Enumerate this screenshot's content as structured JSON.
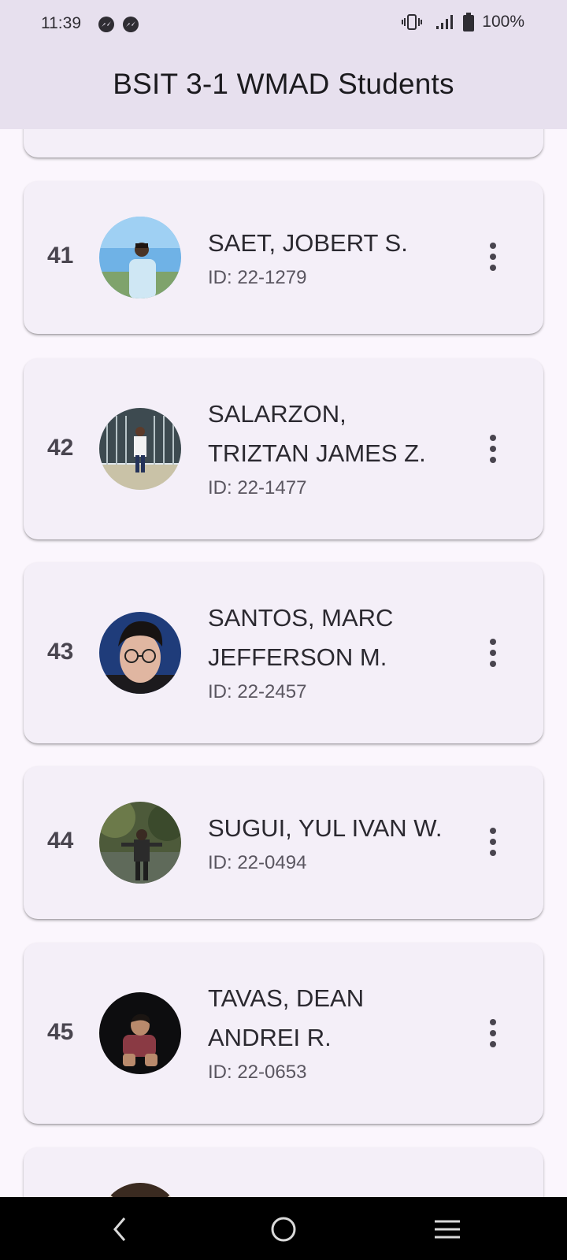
{
  "status_bar": {
    "time": "11:39",
    "battery": "100%",
    "icons": [
      "messenger-icon",
      "messenger-icon",
      "vibrate-icon",
      "signal-icon",
      "battery-icon"
    ]
  },
  "app_bar": {
    "title": "BSIT 3-1 WMAD Students"
  },
  "students": [
    {
      "number": "41",
      "name_lines": [
        "SAET, JOBERT S."
      ],
      "id": "ID: 22-1279",
      "avatar": "photo-sky"
    },
    {
      "number": "42",
      "name_lines": [
        "SALARZON,",
        "TRIZTAN JAMES Z."
      ],
      "id": "ID: 22-1477",
      "avatar": "photo-gate"
    },
    {
      "number": "43",
      "name_lines": [
        "SANTOS, MARC",
        "JEFFERSON M."
      ],
      "id": "ID: 22-2457",
      "avatar": "photo-portrait"
    },
    {
      "number": "44",
      "name_lines": [
        "SUGUI, YUL IVAN W."
      ],
      "id": "ID: 22-0494",
      "avatar": "photo-park"
    },
    {
      "number": "45",
      "name_lines": [
        "TAVAS, DEAN",
        "ANDREI R."
      ],
      "id": "ID: 22-0653",
      "avatar": "photo-night"
    }
  ],
  "nav_bar": {
    "icons": [
      "back-icon",
      "home-icon",
      "recents-icon"
    ]
  },
  "colors": {
    "app_bar": "#e7e0ee",
    "background": "#fbf6fd",
    "card": "#f4eff8",
    "nav_bar": "#000000"
  }
}
